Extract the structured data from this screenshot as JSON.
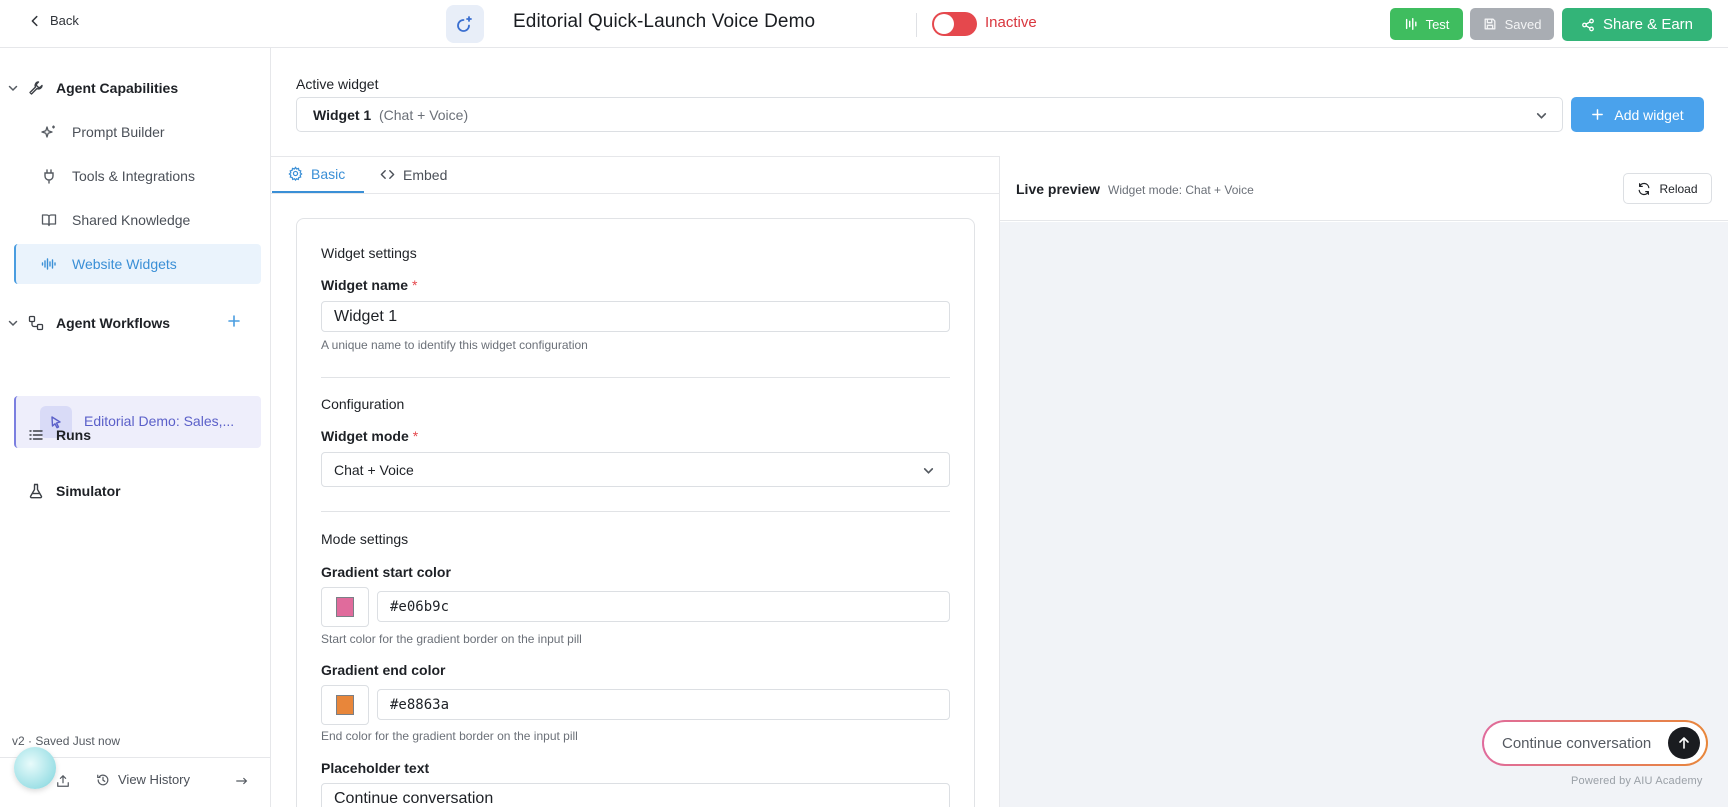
{
  "topbar": {
    "back_label": "Back",
    "title": "Editorial Quick-Launch Voice Demo",
    "status": "Inactive",
    "test_label": "Test",
    "saved_label": "Saved",
    "share_label": "Share & Earn"
  },
  "sidebar": {
    "capabilities": {
      "heading": "Agent Capabilities",
      "items": [
        {
          "label": "Prompt Builder",
          "icon": "sparkles-icon"
        },
        {
          "label": "Tools & Integrations",
          "icon": "plug-icon"
        },
        {
          "label": "Shared Knowledge",
          "icon": "book-icon"
        },
        {
          "label": "Website Widgets",
          "icon": "audio-wave-icon",
          "active": true
        }
      ]
    },
    "workflows": {
      "heading": "Agent Workflows",
      "item": "Editorial Demo: Sales,..."
    },
    "runs_label": "Runs",
    "simulator_label": "Simulator",
    "footer": {
      "version_text": "v2  ·  Saved Just now",
      "history_label": "View History"
    }
  },
  "main": {
    "active_widget_label": "Active widget",
    "widget_select": {
      "name": "Widget 1",
      "mode": "(Chat + Voice)"
    },
    "add_widget_label": "Add widget",
    "tabs": [
      {
        "label": "Basic",
        "active": true
      },
      {
        "label": "Embed",
        "active": false
      }
    ]
  },
  "settings": {
    "section_widget": "Widget settings",
    "name_label": "Widget name",
    "required_mark": "*",
    "name_value": "Widget 1",
    "name_help": "A unique name to identify this widget configuration",
    "section_config": "Configuration",
    "mode_label": "Widget mode",
    "mode_value": "Chat + Voice",
    "section_mode": "Mode settings",
    "gradient_start_label": "Gradient start color",
    "gradient_start_value": "#e06b9c",
    "gradient_start_help": "Start color for the gradient border on the input pill",
    "gradient_end_label": "Gradient end color",
    "gradient_end_value": "#e8863a",
    "gradient_end_help": "End color for the gradient border on the input pill",
    "placeholder_label": "Placeholder text",
    "placeholder_value": "Continue conversation"
  },
  "preview": {
    "title": "Live preview",
    "mode_text": "Widget mode: Chat + Voice",
    "reload_label": "Reload",
    "pill_text": "Continue conversation",
    "powered_by": "Powered by AIU Academy"
  },
  "colors": {
    "accent": "#3a8fd6",
    "inactive": "#e5484d",
    "test_button": "#3fbd5f",
    "share_button": "#33b478",
    "gradient_start": "#e06b9c",
    "gradient_end": "#e8863a"
  }
}
